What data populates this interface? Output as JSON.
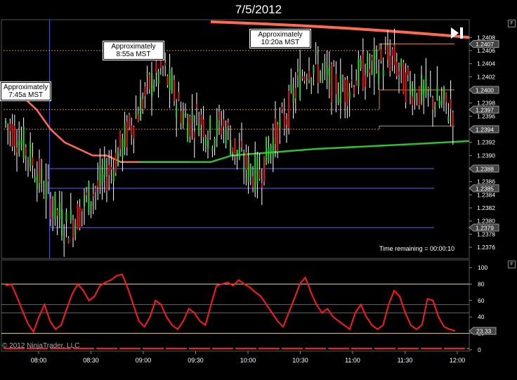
{
  "window": {
    "title": "7/5/2012",
    "f_button": "F"
  },
  "annotations": [
    {
      "line1": "Approximately",
      "line2": "7:45a MST"
    },
    {
      "line1": "Approximately",
      "line2": "8:55a MST"
    },
    {
      "line1": "Approximately",
      "line2": "10:20a MST"
    }
  ],
  "status": {
    "time_remaining": "Time remaining = 00:00:10",
    "copyright": "© 2012 NinjaTrader, LLC"
  },
  "colors": {
    "background": "#000000",
    "bar_up": "#30d030",
    "bar_down": "#e01818",
    "candle_wick": "#ffffff",
    "ma_red": "#ff6a55",
    "ma_green": "#30c030",
    "band_orange": "#e08a2a",
    "level_blue": "#6060ff",
    "oscillator": "#ff1a1a",
    "axis_text": "#ffffff"
  },
  "chart_data": [
    {
      "type": "candlestick",
      "title": "7/5/2012",
      "x_ticks": [
        "08:00",
        "08:30",
        "09:00",
        "09:30",
        "10:00",
        "10:30",
        "11:00",
        "11:30",
        "12:00"
      ],
      "y_ticks": [
        1.2376,
        1.2378,
        1.238,
        1.2382,
        1.2384,
        1.2386,
        1.2388,
        1.239,
        1.2392,
        1.2394,
        1.2396,
        1.2398,
        1.24,
        1.2402,
        1.2404,
        1.2406,
        1.2408
      ],
      "ylim": [
        1.23745,
        1.24105
      ],
      "price_markers": [
        1.2407,
        1.24,
        1.2397,
        1.2394,
        1.2388,
        1.2385,
        1.2379
      ],
      "horizontal_levels": [
        1.2388,
        1.2385,
        1.2379
      ],
      "orange_band_upper": 1.2406,
      "orange_band_mid": 1.2397,
      "orange_band_lower": 1.2394,
      "right_band_upper": 1.2407,
      "right_band_mid": 1.24,
      "right_band_lower": 1.23945,
      "series": [
        {
          "name": "price",
          "values": [
            1.2395,
            1.2393,
            1.239,
            1.2386,
            1.2382,
            1.2379,
            1.2381,
            1.2384,
            1.2386,
            1.2389,
            1.2393,
            1.2397,
            1.2401,
            1.2403,
            1.2399,
            1.2395,
            1.2396,
            1.2393,
            1.2395,
            1.2391,
            1.2388,
            1.2387,
            1.2392,
            1.2395,
            1.24,
            1.2404,
            1.2403,
            1.2401,
            1.24,
            1.2402,
            1.2403,
            1.2404,
            1.2405,
            1.2401,
            1.24,
            1.2399,
            1.2398,
            1.2397
          ]
        },
        {
          "name": "ma_red",
          "values": [
            1.2399,
            1.2397,
            1.2394,
            1.2392,
            1.2391,
            1.239,
            1.239,
            1.2389,
            1.2389,
            1.2389,
            1.2389,
            1.2389,
            1.2389
          ]
        },
        {
          "name": "ma_green",
          "values": [
            1.2389,
            1.239,
            1.2391,
            1.2392
          ]
        }
      ]
    },
    {
      "type": "line",
      "name": "oscillator",
      "y_ticks": [
        0,
        20,
        40,
        60,
        80,
        100
      ],
      "ylim": [
        0,
        100
      ],
      "reference_lines": [
        20,
        45,
        55,
        80
      ],
      "last_value_label": "23.33",
      "values": [
        78,
        80,
        65,
        48,
        32,
        22,
        40,
        55,
        35,
        25,
        30,
        50,
        68,
        80,
        72,
        60,
        65,
        78,
        82,
        85,
        90,
        92,
        75,
        55,
        35,
        28,
        40,
        60,
        55,
        40,
        30,
        25,
        35,
        50,
        45,
        35,
        30,
        55,
        78,
        80,
        82,
        78,
        85,
        80,
        76,
        70,
        65,
        55,
        45,
        35,
        28,
        45,
        62,
        80,
        88,
        70,
        55,
        45,
        50,
        40,
        35,
        30,
        25,
        45,
        55,
        40,
        30,
        25,
        30,
        55,
        72,
        65,
        45,
        30,
        25,
        30,
        62,
        60,
        40,
        28,
        25,
        23
      ]
    }
  ]
}
